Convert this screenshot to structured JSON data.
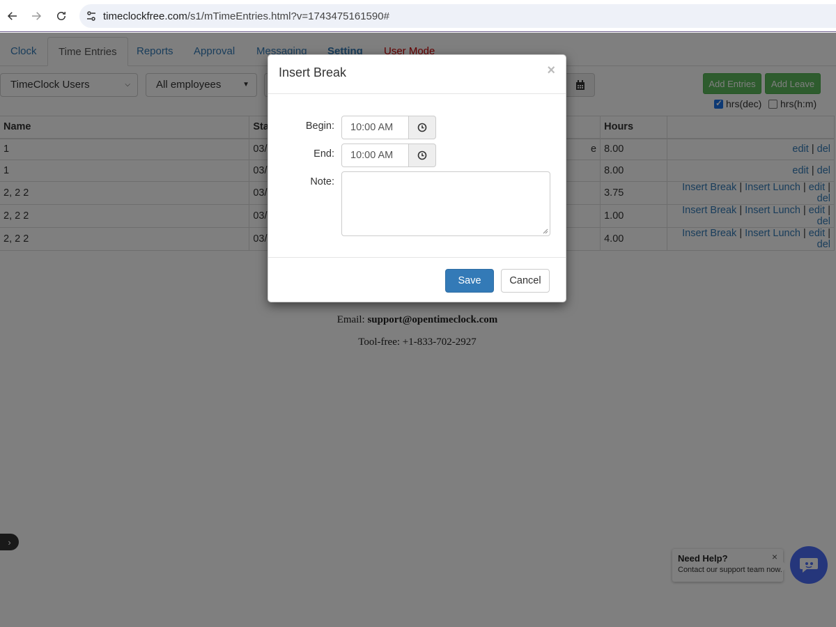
{
  "browser": {
    "url_host": "timeclockfree.com",
    "url_path": "/s1/mTimeEntries.html?v=1743475161590#"
  },
  "tabs": [
    {
      "label": "Clock"
    },
    {
      "label": "Time Entries"
    },
    {
      "label": "Reports"
    },
    {
      "label": "Approval"
    },
    {
      "label": "Messaging"
    },
    {
      "label": "Setting"
    },
    {
      "label": "User Mode"
    }
  ],
  "filters": {
    "group_select": "TimeClock Users",
    "employee_select": "All employees"
  },
  "actions": {
    "add_entries": "Add Entries",
    "add_leave": "Add Leave",
    "hrs_dec_label": "hrs(dec)",
    "hrs_dec_checked": true,
    "hrs_hm_label": "hrs(h:m)",
    "hrs_hm_checked": false
  },
  "table": {
    "headers": {
      "name": "Name",
      "start": "Sta",
      "hours": "Hours"
    },
    "rows": [
      {
        "name": "1",
        "start": "03/",
        "hours": "8.00",
        "extra": "e"
      },
      {
        "name": "1",
        "start": "03/",
        "hours": "8.00",
        "extra": ""
      },
      {
        "name": "2, 2 2",
        "start": "03/",
        "hours": "3.75",
        "extra": ""
      },
      {
        "name": "2, 2 2",
        "start": "03/",
        "hours": "1.00",
        "extra": ""
      },
      {
        "name": "2, 2 2",
        "start": "03/",
        "hours": "4.00",
        "extra": ""
      }
    ],
    "links": {
      "insert_break": "Insert Break",
      "insert_lunch": "Insert Lunch",
      "edit": "edit",
      "del": "del",
      "sep": "|"
    }
  },
  "footer": {
    "email_label": "Email:",
    "email": "support@opentimeclock.com",
    "tollfree": "Tool-free: +1-833-702-2927"
  },
  "help": {
    "title": "Need Help?",
    "subtitle": "Contact our support team now.",
    "close": "×"
  },
  "modal": {
    "title": "Insert Break",
    "close": "×",
    "begin_label": "Begin:",
    "begin_value": "10:00 AM",
    "end_label": "End:",
    "end_value": "10:00 AM",
    "note_label": "Note:",
    "save": "Save",
    "cancel": "Cancel"
  },
  "colors": {
    "accent": "#337ab7",
    "success": "#5cb85c",
    "chat": "#4a6cf7"
  }
}
